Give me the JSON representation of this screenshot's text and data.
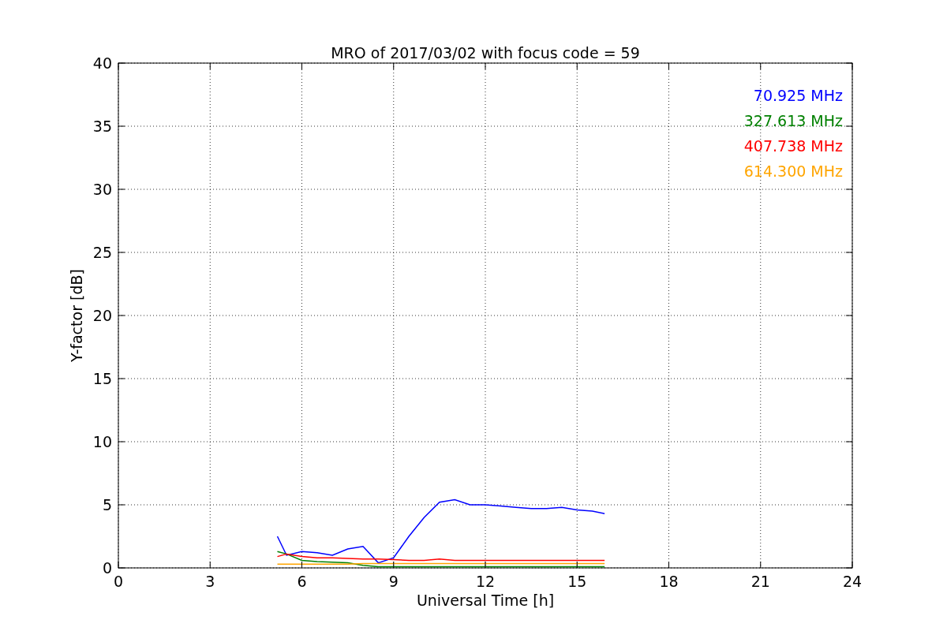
{
  "chart_data": {
    "type": "line",
    "title": "MRO of 2017/03/02 with focus code = 59",
    "xlabel": "Universal Time [h]",
    "ylabel": "Y-factor [dB]",
    "x": [
      5.2,
      5.5,
      6,
      6.5,
      7,
      7.5,
      8,
      8.5,
      9,
      9.5,
      10,
      10.5,
      11,
      11.5,
      12,
      12.5,
      13,
      13.5,
      14,
      14.5,
      15,
      15.5,
      15.9
    ],
    "series": [
      {
        "name": "70.925 MHz",
        "color": "#0000ff",
        "values": [
          2.5,
          1.0,
          1.3,
          1.2,
          1.0,
          1.5,
          1.7,
          0.4,
          0.8,
          2.5,
          4.0,
          5.2,
          5.4,
          5.0,
          5.0,
          4.9,
          4.8,
          4.7,
          4.7,
          4.8,
          4.6,
          4.5,
          4.3
        ]
      },
      {
        "name": "327.613 MHz",
        "color": "#008000",
        "values": [
          1.3,
          1.1,
          0.6,
          0.5,
          0.45,
          0.4,
          0.2,
          0.1,
          0.1,
          0.1,
          0.1,
          0.1,
          0.1,
          0.1,
          0.1,
          0.1,
          0.1,
          0.1,
          0.1,
          0.1,
          0.1,
          0.1,
          0.1
        ]
      },
      {
        "name": "407.738 MHz",
        "color": "#ff0000",
        "values": [
          0.9,
          1.1,
          0.9,
          0.8,
          0.8,
          0.75,
          0.7,
          0.7,
          0.65,
          0.6,
          0.6,
          0.7,
          0.6,
          0.6,
          0.6,
          0.6,
          0.6,
          0.6,
          0.6,
          0.6,
          0.6,
          0.6,
          0.6
        ]
      },
      {
        "name": "614.300 MHz",
        "color": "#ffa500",
        "values": [
          0.3,
          0.3,
          0.3,
          0.3,
          0.3,
          0.3,
          0.35,
          0.35,
          0.35,
          0.35,
          0.35,
          0.35,
          0.35,
          0.35,
          0.35,
          0.35,
          0.35,
          0.35,
          0.35,
          0.35,
          0.35,
          0.35,
          0.35
        ]
      }
    ],
    "xlim": [
      0,
      24
    ],
    "ylim": [
      0,
      40
    ],
    "xticks": [
      0,
      3,
      6,
      9,
      12,
      15,
      18,
      21,
      24
    ],
    "yticks": [
      0,
      5,
      10,
      15,
      20,
      25,
      30,
      35,
      40
    ],
    "grid": true
  }
}
